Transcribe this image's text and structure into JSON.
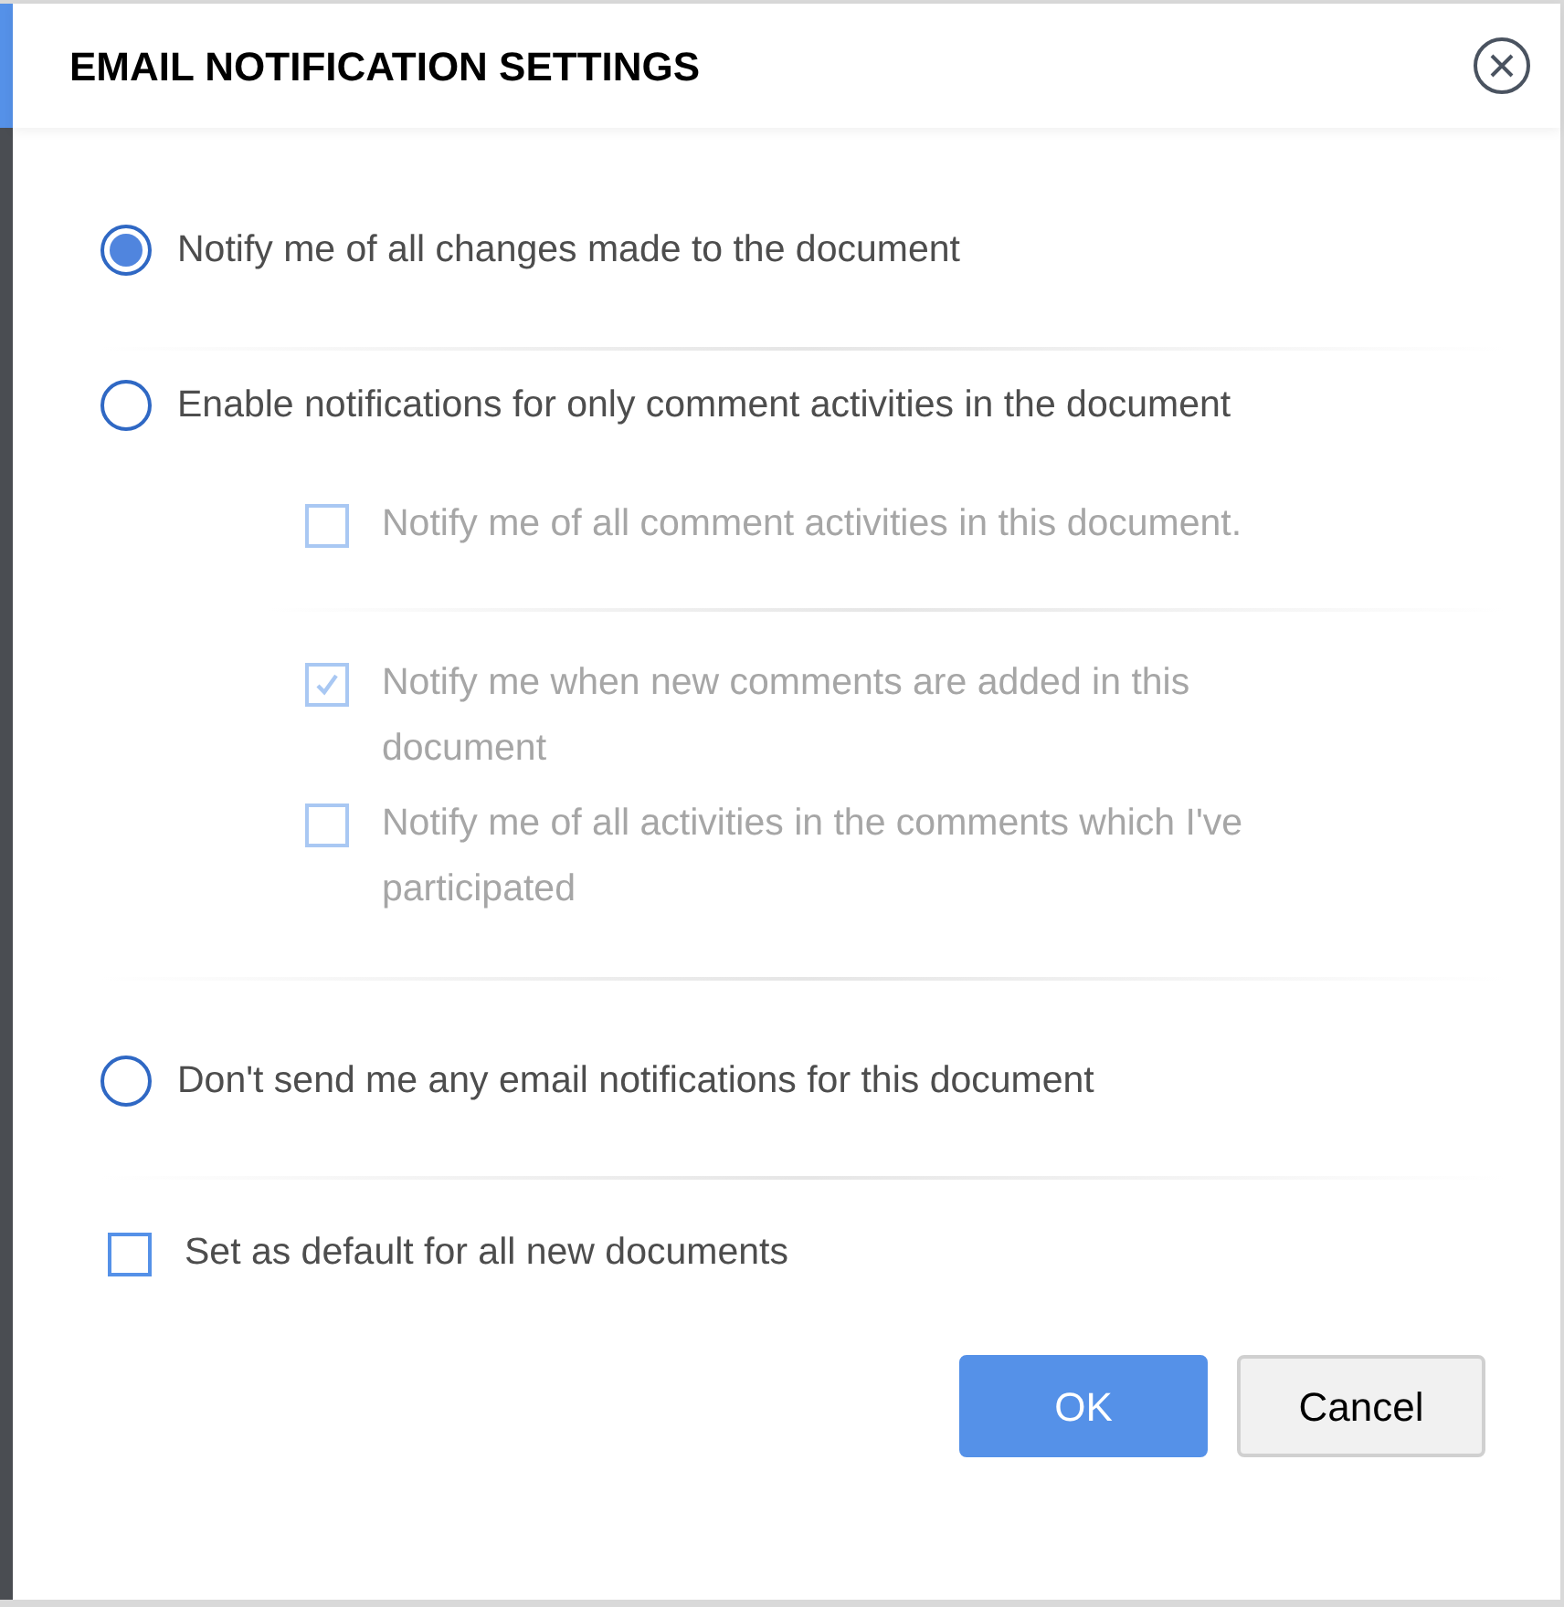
{
  "dialog": {
    "title": "EMAIL NOTIFICATION SETTINGS"
  },
  "options": [
    {
      "label": "Notify me of all changes made to the document",
      "selected": true
    },
    {
      "label": "Enable notifications for only comment activities in the document",
      "selected": false,
      "suboptions_disabled": true,
      "suboptions": [
        {
          "label": "Notify me of all comment activities in this document.",
          "checked": false
        },
        {
          "label": "Notify me when new comments are added in this document",
          "checked": true
        },
        {
          "label": "Notify me of all activities in the comments which I've participated",
          "checked": false
        }
      ]
    },
    {
      "label": "Don't send me any email notifications for this document",
      "selected": false
    }
  ],
  "default_checkbox": {
    "label": "Set as default for all new documents",
    "checked": false
  },
  "buttons": [
    {
      "label": "OK",
      "kind": "primary"
    },
    {
      "label": "Cancel",
      "kind": "secondary"
    }
  ]
}
